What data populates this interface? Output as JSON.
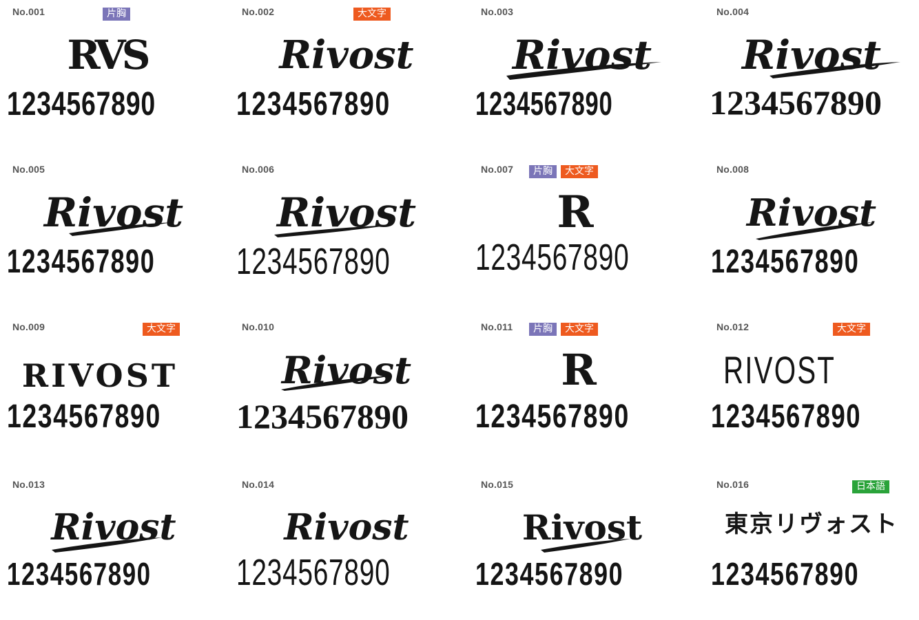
{
  "colors": {
    "katamune": "#7b75b8",
    "oomoji": "#ee5a1f",
    "nihongo": "#2aa33a",
    "ink": "#141414"
  },
  "items": [
    {
      "no": "No.001",
      "badges": [
        {
          "label": "片胸",
          "type": "katamune"
        }
      ],
      "logo": "RVS",
      "digits": "1234567890"
    },
    {
      "no": "No.002",
      "badges": [
        {
          "label": "大文字",
          "type": "oomoji"
        }
      ],
      "logo": "Rivost",
      "digits": "1234567890"
    },
    {
      "no": "No.003",
      "badges": [],
      "logo": "Rivost",
      "digits": "1234567890"
    },
    {
      "no": "No.004",
      "badges": [],
      "logo": "Rivost",
      "digits": "1234567890"
    },
    {
      "no": "No.005",
      "badges": [],
      "logo": "Rivost",
      "digits": "1234567890"
    },
    {
      "no": "No.006",
      "badges": [],
      "logo": "Rivost",
      "digits": "1234567890"
    },
    {
      "no": "No.007",
      "badges": [
        {
          "label": "片胸",
          "type": "katamune"
        },
        {
          "label": "大文字",
          "type": "oomoji"
        }
      ],
      "logo": "R",
      "digits": "1234567890"
    },
    {
      "no": "No.008",
      "badges": [],
      "logo": "Rivost",
      "digits": "1234567890"
    },
    {
      "no": "No.009",
      "badges": [
        {
          "label": "大文字",
          "type": "oomoji"
        }
      ],
      "logo": "RIVOST",
      "digits": "1234567890"
    },
    {
      "no": "No.010",
      "badges": [],
      "logo": "Rivost",
      "digits": "1234567890"
    },
    {
      "no": "No.011",
      "badges": [
        {
          "label": "片胸",
          "type": "katamune"
        },
        {
          "label": "大文字",
          "type": "oomoji"
        }
      ],
      "logo": "R",
      "digits": "1234567890"
    },
    {
      "no": "No.012",
      "badges": [
        {
          "label": "大文字",
          "type": "oomoji"
        }
      ],
      "logo": "RIVOST",
      "digits": "1234567890"
    },
    {
      "no": "No.013",
      "badges": [],
      "logo": "Rivost",
      "digits": "1234567890"
    },
    {
      "no": "No.014",
      "badges": [],
      "logo": "Rivost",
      "digits": "1234567890"
    },
    {
      "no": "No.015",
      "badges": [],
      "logo": "Rivost",
      "digits": "1234567890"
    },
    {
      "no": "No.016",
      "badges": [
        {
          "label": "日本語",
          "type": "nihongo"
        }
      ],
      "logo": "東京リヴォスト",
      "digits": "1234567890"
    }
  ]
}
